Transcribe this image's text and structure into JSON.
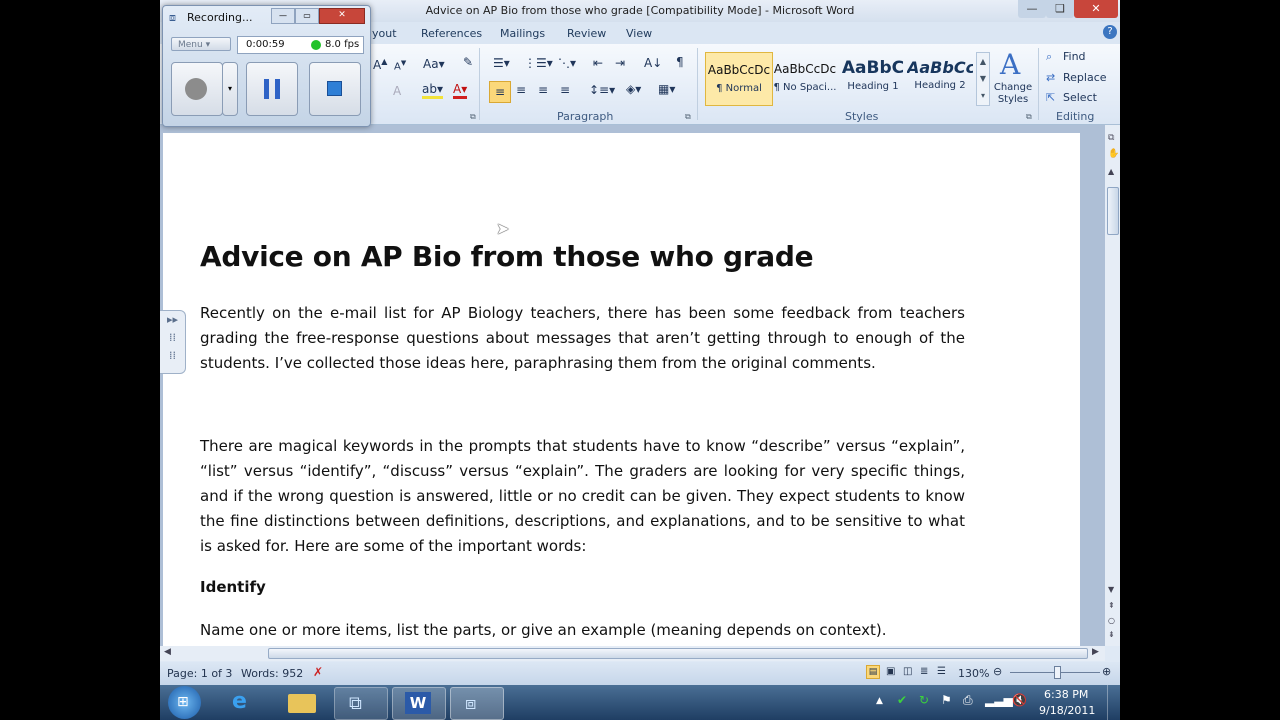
{
  "window": {
    "title": "Advice on AP Bio from those who grade [Compatibility Mode] - Microsoft Word"
  },
  "ribbon": {
    "tabs": [
      "yout",
      "References",
      "Mailings",
      "Review",
      "View"
    ],
    "groups": {
      "paragraph": "Paragraph",
      "styles": "Styles",
      "editing": "Editing"
    },
    "styles": [
      {
        "preview": "AaBbCcDc",
        "name": "¶ Normal"
      },
      {
        "preview": "AaBbCcDc",
        "name": "¶ No Spaci..."
      },
      {
        "preview": "AaBbC",
        "name": "Heading 1"
      },
      {
        "preview": "AaBbCc",
        "name": "Heading 2"
      }
    ],
    "change_styles": "Change Styles",
    "find": "Find",
    "replace": "Replace",
    "select": "Select"
  },
  "recorder": {
    "title": "Recording...",
    "menu": "Menu",
    "time": "0:00:59",
    "fps": "8.0 fps"
  },
  "document": {
    "heading": "Advice on AP Bio from those who grade",
    "p1": "Recently on the e-mail list for AP Biology teachers, there has been some feedback from teachers grading the free-response questions about messages that aren’t getting through to enough of the students. I’ve collected those ideas here, paraphrasing them from the original comments.",
    "p2": "There are magical keywords in the prompts that students have to know “describe” versus “explain”, “list” versus “identify”, “discuss” versus “explain”. The graders are looking for very specific things, and if the wrong question is answered, little or no credit can be given. They expect students to know the fine distinctions between definitions, descriptions, and explanations, and to be sensitive to what is asked for. Here are some of the important words:",
    "subheading": "Identify",
    "p3": "Name one or more items, list the parts, or give an example (meaning depends on context)."
  },
  "status": {
    "page": "Page: 1 of 3",
    "words": "Words: 952",
    "zoom": "130%"
  },
  "taskbar": {
    "time": "6:38 PM",
    "date": "9/18/2011"
  }
}
